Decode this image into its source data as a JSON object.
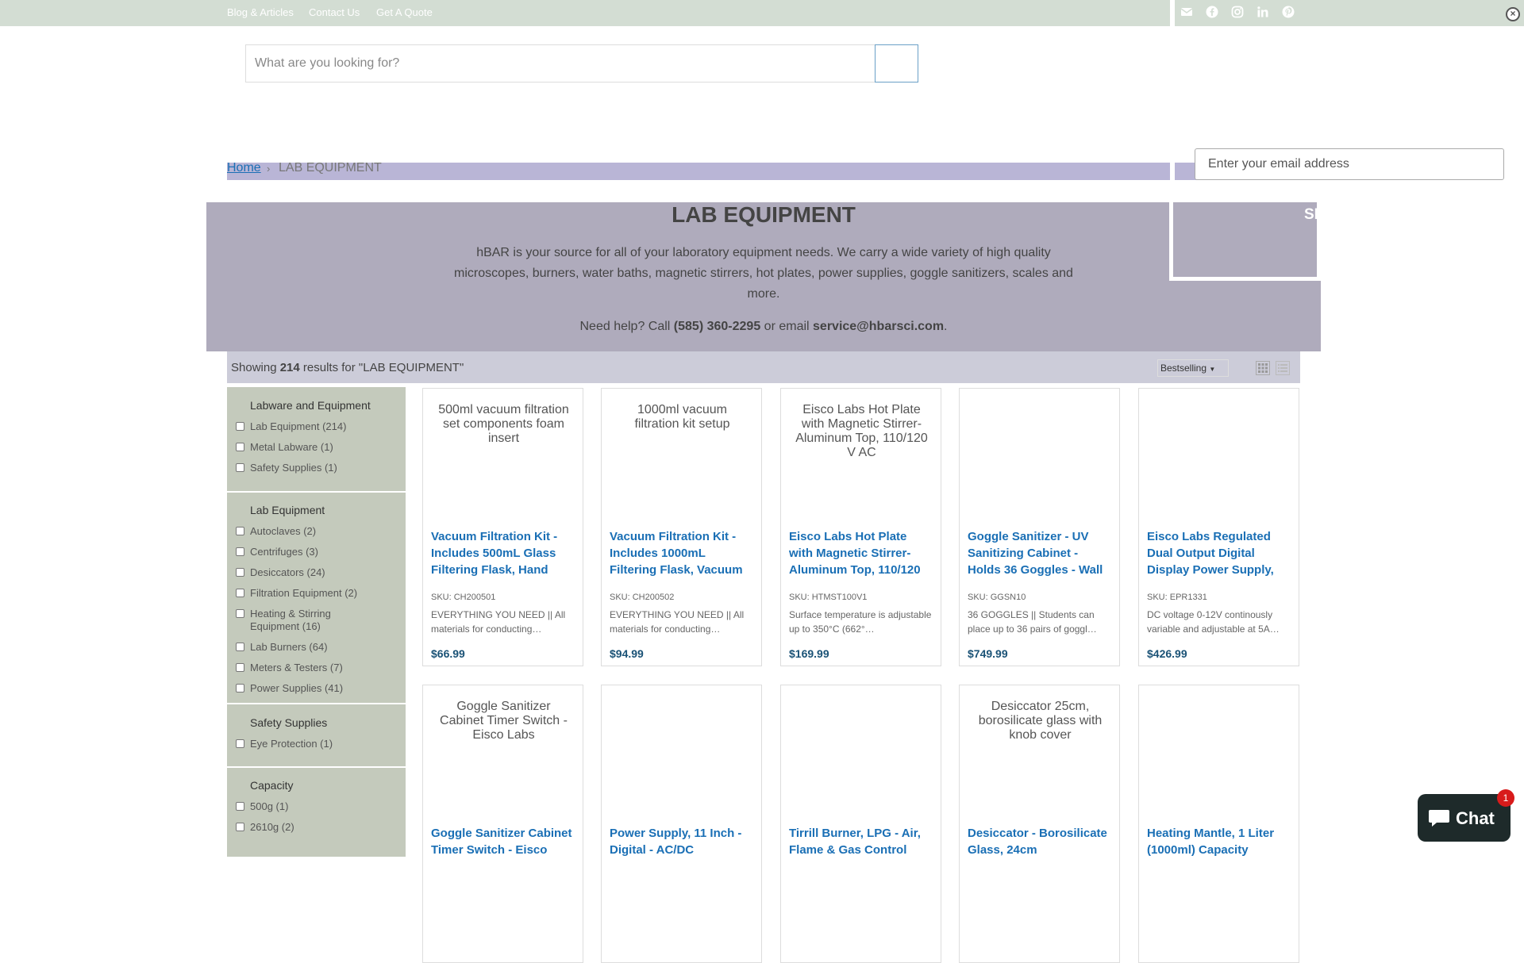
{
  "topbar": {
    "links": [
      "Blog & Articles",
      "Contact Us",
      "Get A Quote"
    ],
    "social_icons": [
      "mail-icon",
      "facebook-icon",
      "instagram-icon",
      "linkedin-icon",
      "pinterest-icon"
    ]
  },
  "search": {
    "placeholder": "What are you looking for?"
  },
  "breadcrumb": {
    "home": "Home",
    "current": "LAB EQUIPMENT"
  },
  "popup": {
    "email_placeholder": "Enter your email address",
    "signup_label": "SIG"
  },
  "hero": {
    "title": "LAB EQUIPMENT",
    "description": "hBAR is your source for all of your laboratory equipment needs. We carry a wide variety of high quality microscopes, burners, water baths, magnetic stirrers, hot plates, power supplies, goggle sanitizers, scales and more.",
    "help_prefix": "Need help? Call ",
    "phone": "(585) 360-2295",
    "help_mid": " or email ",
    "email": "service@hbarsci.com",
    "help_suffix": "."
  },
  "results": {
    "prefix": "Showing ",
    "count": "214",
    "suffix": " results for \"LAB EQUIPMENT\"",
    "sort": "Bestselling"
  },
  "sidebar": {
    "groups": [
      {
        "heading": "Labware and Equipment",
        "items": [
          "Lab Equipment (214)",
          "Metal Labware (1)",
          "Safety Supplies (1)"
        ]
      },
      {
        "heading": "Lab Equipment",
        "items": [
          "Autoclaves (2)",
          "Centrifuges (3)",
          "Desiccators (24)",
          "Filtration Equipment (2)",
          "Heating & Stirring Equipment (16)",
          "Lab Burners (64)",
          "Meters & Testers (7)",
          "Power Supplies (41)"
        ]
      },
      {
        "heading": "Safety Supplies",
        "items": [
          "Eye Protection (1)"
        ]
      },
      {
        "heading": "Capacity",
        "items": [
          "500g (1)",
          "2610g (2)"
        ]
      }
    ]
  },
  "products": [
    {
      "alt": "500ml vacuum filtration set components foam insert",
      "title": "Vacuum Filtration Kit - Includes 500mL Glass Filtering Flask, Hand",
      "sku": "SKU: CH200501",
      "desc": "EVERYTHING YOU NEED || All materials for conducting…",
      "price": "$66.99"
    },
    {
      "alt": "1000ml vacuum filtration kit setup",
      "title": "Vacuum Filtration Kit - Includes 1000mL Filtering Flask, Vacuum",
      "sku": "SKU: CH200502",
      "desc": "EVERYTHING YOU NEED || All materials for conducting…",
      "price": "$94.99"
    },
    {
      "alt": "Eisco Labs Hot Plate with Magnetic Stirrer- Aluminum Top, 110/120 V AC",
      "title": "Eisco Labs Hot Plate with Magnetic Stirrer- Aluminum Top, 110/120",
      "sku": "SKU: HTMST100V1",
      "desc": "Surface temperature is adjustable up to 350°C (662°…",
      "price": "$169.99"
    },
    {
      "alt": "",
      "title": "Goggle Sanitizer - UV Sanitizing Cabinet - Holds 36 Goggles - Wall",
      "sku": "SKU: GGSN10",
      "desc": "36 GOGGLES || Students can place up to 36 pairs of goggl…",
      "price": "$749.99"
    },
    {
      "alt": "",
      "title": "Eisco Labs Regulated Dual Output Digital Display Power Supply,",
      "sku": "SKU: EPR1331",
      "desc": "DC voltage 0-12V continously variable and adjustable at 5A…",
      "price": "$426.99"
    },
    {
      "alt": "Goggle Sanitizer Cabinet Timer Switch - Eisco Labs",
      "title": "Goggle Sanitizer Cabinet Timer Switch - Eisco",
      "sku": "",
      "desc": "",
      "price": ""
    },
    {
      "alt": "",
      "title": "Power Supply, 11 Inch - Digital - AC/DC",
      "sku": "",
      "desc": "",
      "price": ""
    },
    {
      "alt": "",
      "title": "Tirrill Burner, LPG - Air, Flame & Gas Control",
      "sku": "",
      "desc": "",
      "price": ""
    },
    {
      "alt": "Desiccator 25cm, borosilicate glass with knob cover",
      "title": "Desiccator - Borosilicate Glass, 24cm",
      "sku": "",
      "desc": "",
      "price": ""
    },
    {
      "alt": "",
      "title": "Heating Mantle, 1 Liter (1000ml) Capacity",
      "sku": "",
      "desc": "",
      "price": ""
    }
  ],
  "chat": {
    "label": "Chat",
    "badge": "1"
  }
}
